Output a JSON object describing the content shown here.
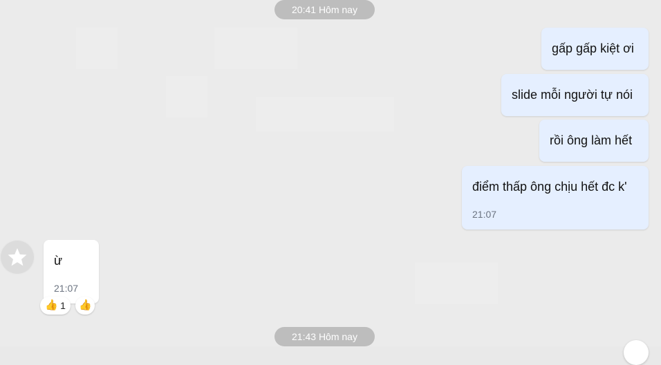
{
  "timestamps": {
    "top": "20:41 Hôm nay",
    "bottom": "21:43 Hôm nay"
  },
  "messages": {
    "out": [
      {
        "text": "gấp gấp kiệt ơi"
      },
      {
        "text": "slide mỗi người tự nói"
      },
      {
        "text": "rồi ông làm hết"
      },
      {
        "text": "điểm thấp ông chịu hết đc k'",
        "time": "21:07"
      }
    ],
    "in": [
      {
        "text": "ừ",
        "time": "21:07"
      }
    ]
  },
  "reactions": {
    "count_label": "1",
    "icon": "thumbs-up-icon"
  },
  "avatar": {
    "icon": "star-icon"
  },
  "colors": {
    "outgoing_bubble": "#e5efff",
    "incoming_bubble": "#ffffff",
    "timestamp_pill": "#bdbdbd",
    "background": "#ebebeb"
  }
}
